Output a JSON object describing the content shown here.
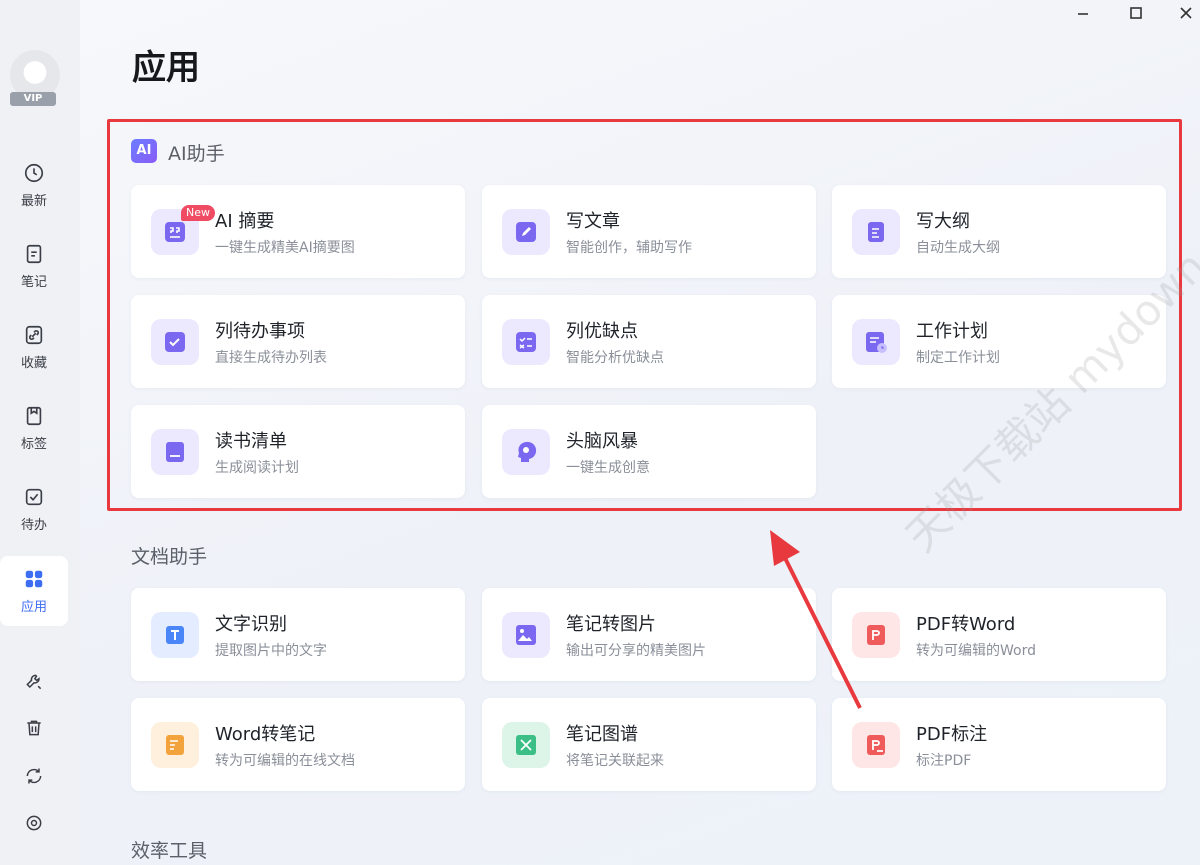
{
  "sidebar": {
    "vip_label": "VIP",
    "items": [
      {
        "label": "最新",
        "icon": "clock-icon"
      },
      {
        "label": "笔记",
        "icon": "note-icon"
      },
      {
        "label": "收藏",
        "icon": "link-icon"
      },
      {
        "label": "标签",
        "icon": "bookmark-icon"
      },
      {
        "label": "待办",
        "icon": "checkbox-icon"
      },
      {
        "label": "应用",
        "icon": "apps-grid-icon"
      }
    ],
    "bottom_icons": [
      "wrench-icon",
      "trash-icon",
      "sync-icon",
      "settings-icon"
    ]
  },
  "page": {
    "title": "应用"
  },
  "ai_section": {
    "badge": "AI",
    "title": "AI助手",
    "cards": [
      {
        "title": "AI 摘要",
        "subtitle": "一键生成精美AI摘要图",
        "icon": "quote-icon",
        "tag": "New"
      },
      {
        "title": "写文章",
        "subtitle": "智能创作，辅助写作",
        "icon": "pen-icon"
      },
      {
        "title": "写大纲",
        "subtitle": "自动生成大纲",
        "icon": "outline-icon"
      },
      {
        "title": "列待办事项",
        "subtitle": "直接生成待办列表",
        "icon": "check-icon"
      },
      {
        "title": "列优缺点",
        "subtitle": "智能分析优缺点",
        "icon": "pros-cons-icon"
      },
      {
        "title": "工作计划",
        "subtitle": "制定工作计划",
        "icon": "plan-icon"
      },
      {
        "title": "读书清单",
        "subtitle": "生成阅读计划",
        "icon": "book-icon"
      },
      {
        "title": "头脑风暴",
        "subtitle": "一键生成创意",
        "icon": "brain-icon"
      }
    ]
  },
  "doc_section": {
    "title": "文档助手",
    "cards": [
      {
        "title": "文字识别",
        "subtitle": "提取图片中的文字",
        "icon": "ocr-icon"
      },
      {
        "title": "笔记转图片",
        "subtitle": "输出可分享的精美图片",
        "icon": "image-icon"
      },
      {
        "title": "PDF转Word",
        "subtitle": "转为可编辑的Word",
        "icon": "pdf-icon"
      },
      {
        "title": "Word转笔记",
        "subtitle": "转为可编辑的在线文档",
        "icon": "word-icon"
      },
      {
        "title": "笔记图谱",
        "subtitle": "将笔记关联起来",
        "icon": "graph-icon"
      },
      {
        "title": "PDF标注",
        "subtitle": "标注PDF",
        "icon": "pdf-annotate-icon"
      }
    ]
  },
  "efficiency_section": {
    "title": "效率工具"
  },
  "watermark": "天极下载站 mydown.yesky.com",
  "colors": {
    "accent": "#3d6df2",
    "highlight": "#e8393f",
    "purple_icon": "#7b68f0"
  }
}
